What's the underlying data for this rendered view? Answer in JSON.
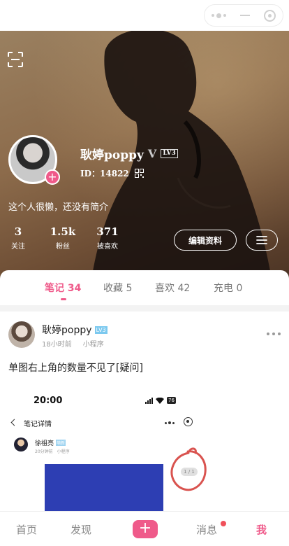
{
  "profile": {
    "username": "耿婷poppy",
    "verified_mark": "V",
    "level": "LV3",
    "id_text": "ID：14822",
    "bio": "这个人很懒，还没有简介",
    "stats": [
      {
        "num": "3",
        "label": "关注"
      },
      {
        "num": "1.5k",
        "label": "粉丝"
      },
      {
        "num": "371",
        "label": "被喜欢"
      }
    ],
    "edit_label": "编辑资料"
  },
  "tabs": [
    {
      "label": "笔记 34",
      "active": true
    },
    {
      "label": "收藏 5",
      "active": false
    },
    {
      "label": "喜欢 42",
      "active": false
    },
    {
      "label": "充电 0",
      "active": false
    }
  ],
  "post": {
    "author": "耿婷poppy",
    "level": "LV3",
    "time": "18小时前",
    "source": "小程序",
    "text": "单图右上角的数量不见了[疑问]",
    "screenshot": {
      "time": "20:00",
      "battery": "76",
      "title": "笔记详情",
      "user": "徐祖亮",
      "user_badge": "萌新",
      "meta_time": "20分钟前",
      "meta_source": "小程序",
      "count": "1 / 1"
    }
  },
  "nav": {
    "items": [
      "首页",
      "发现",
      "消息",
      "我"
    ],
    "active": "我",
    "plus": "+"
  },
  "colors": {
    "accent": "#ef5a8a",
    "notice_dot": "#f0505a"
  }
}
